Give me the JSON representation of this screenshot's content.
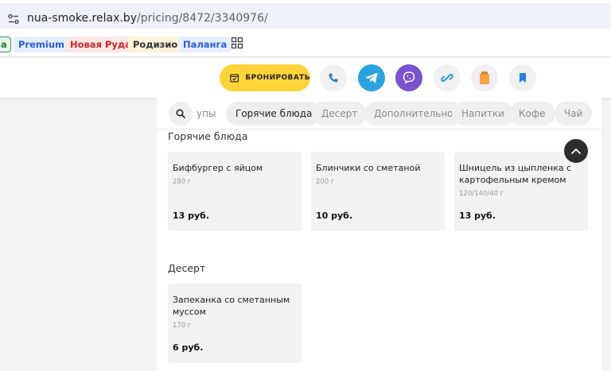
{
  "browser": {
    "url_host": "nua-smoke.relax.by",
    "url_path": "/pricing/8472/3340976/"
  },
  "bookmarks": [
    {
      "label": "а",
      "bg": "#e7f6ea",
      "fg": "#1e7a33"
    },
    {
      "label": "Premium",
      "bg": "#e6efff",
      "fg": "#2a5bd7"
    },
    {
      "label": "Новая Руда",
      "bg": "#fde7e7",
      "fg": "#c62828"
    },
    {
      "label": "Родизио",
      "bg": "#fdf3dc",
      "fg": "#333333"
    },
    {
      "label": "Паланга",
      "bg": "#e6efff",
      "fg": "#2a5bd7"
    }
  ],
  "header": {
    "book_label": "БРОНИРОВАТЬ",
    "accent": "#ffd43a",
    "icons": [
      "phone-icon",
      "telegram-icon",
      "viber-icon",
      "link-icon",
      "bag-icon",
      "bookmark-icon"
    ]
  },
  "categories": {
    "items": [
      "упы",
      "Горячие блюда",
      "Десерт",
      "Дополнительно",
      "Напитки",
      "Кофе",
      "Чай"
    ],
    "active": "Горячие блюда"
  },
  "sections": [
    {
      "title": "Горячие блюда",
      "items": [
        {
          "name": "Бифбургер с яйцом",
          "weight": "280 г",
          "price": "13 руб."
        },
        {
          "name": "Блинчики со сметаной",
          "weight": "200 г",
          "price": "10 руб."
        },
        {
          "name": "Шницель из цыпленка с картофельным кремом",
          "weight": "120/140/40 г",
          "price": "13 руб."
        }
      ]
    },
    {
      "title": "Десерт",
      "items": [
        {
          "name": "Запеканка со сметанным муссом",
          "weight": "170 г",
          "price": "6 руб."
        }
      ]
    }
  ]
}
